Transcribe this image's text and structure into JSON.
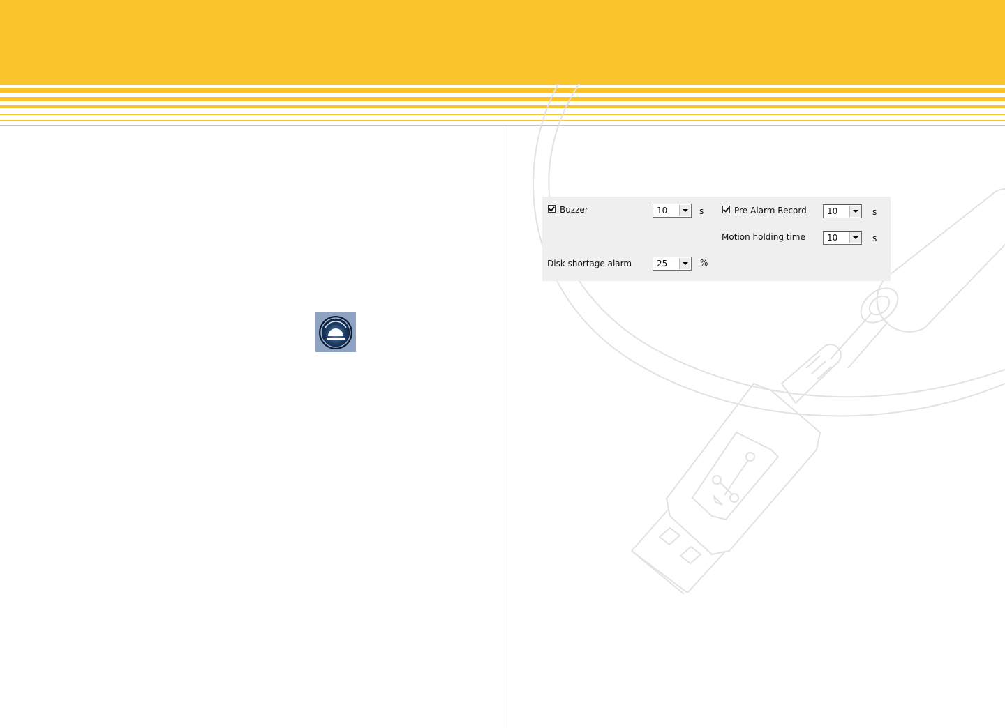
{
  "colors": {
    "brand_yellow": "#f9c42c",
    "panel_bg": "#efefef"
  },
  "icons": {
    "alarm": "alarm-siren-icon",
    "background_art": "usb-plug-icon"
  },
  "settings": {
    "buzzer": {
      "label": "Buzzer",
      "checked": true,
      "value": "10",
      "unit": "s"
    },
    "pre_alarm_record": {
      "label": "Pre-Alarm Record",
      "checked": true,
      "value": "10",
      "unit": "s"
    },
    "motion_holding_time": {
      "label": "Motion holding time",
      "value": "10",
      "unit": "s"
    },
    "disk_shortage_alarm": {
      "label": "Disk shortage alarm",
      "value": "25",
      "unit": "%"
    }
  }
}
